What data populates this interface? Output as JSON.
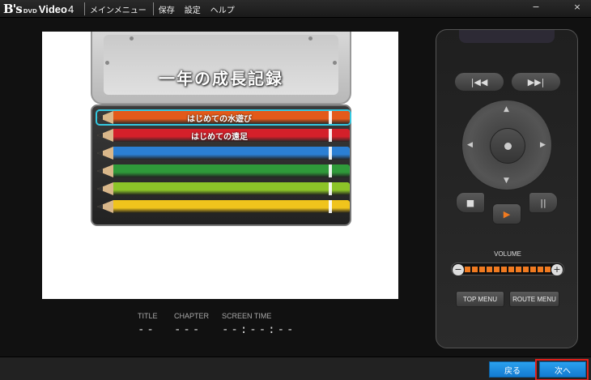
{
  "app": {
    "logo": {
      "b": "B's",
      "dvd": "DVD",
      "video": "Video",
      "version": "4"
    },
    "menu": [
      "メインメニュー",
      "保存",
      "設定",
      "ヘルプ"
    ],
    "window_controls": [
      "−",
      "×"
    ]
  },
  "preview": {
    "disc_title": "一年の成長記録",
    "chapters": [
      {
        "label": "はじめての水遊び",
        "color": "#e35a1a",
        "selected": true
      },
      {
        "label": "はじめての遠足",
        "color": "#d4202a",
        "selected": false
      },
      {
        "label": "",
        "color": "#2b7fd4",
        "selected": false
      },
      {
        "label": "",
        "color": "#2f9a3a",
        "selected": false
      },
      {
        "label": "",
        "color": "#8cc428",
        "selected": false
      },
      {
        "label": "",
        "color": "#f0c41c",
        "selected": false
      }
    ]
  },
  "info": {
    "title_label": "TITLE",
    "title_value": "--",
    "chapter_label": "CHAPTER",
    "chapter_value": "---",
    "screen_time_label": "SCREEN TIME",
    "screen_time_value": "--:--:--"
  },
  "remote": {
    "prev_symbol": "|◀◀",
    "next_symbol": "▶▶|",
    "up": "▲",
    "down": "▼",
    "left": "◀",
    "right": "▶",
    "stop_symbol": "■",
    "play_symbol": "▶",
    "pause_symbol": "||",
    "volume_label": "VOLUME",
    "volume_minus": "−",
    "volume_plus": "+",
    "volume_level": 1.0,
    "top_menu": "TOP MENU",
    "route_menu": "ROUTE MENU"
  },
  "footer": {
    "back": "戻る",
    "next": "次へ"
  },
  "colors": {
    "accent": "#1a8fe3",
    "highlight": "#e0201c",
    "volume": "#f07a20",
    "selection": "#34c8e0"
  }
}
